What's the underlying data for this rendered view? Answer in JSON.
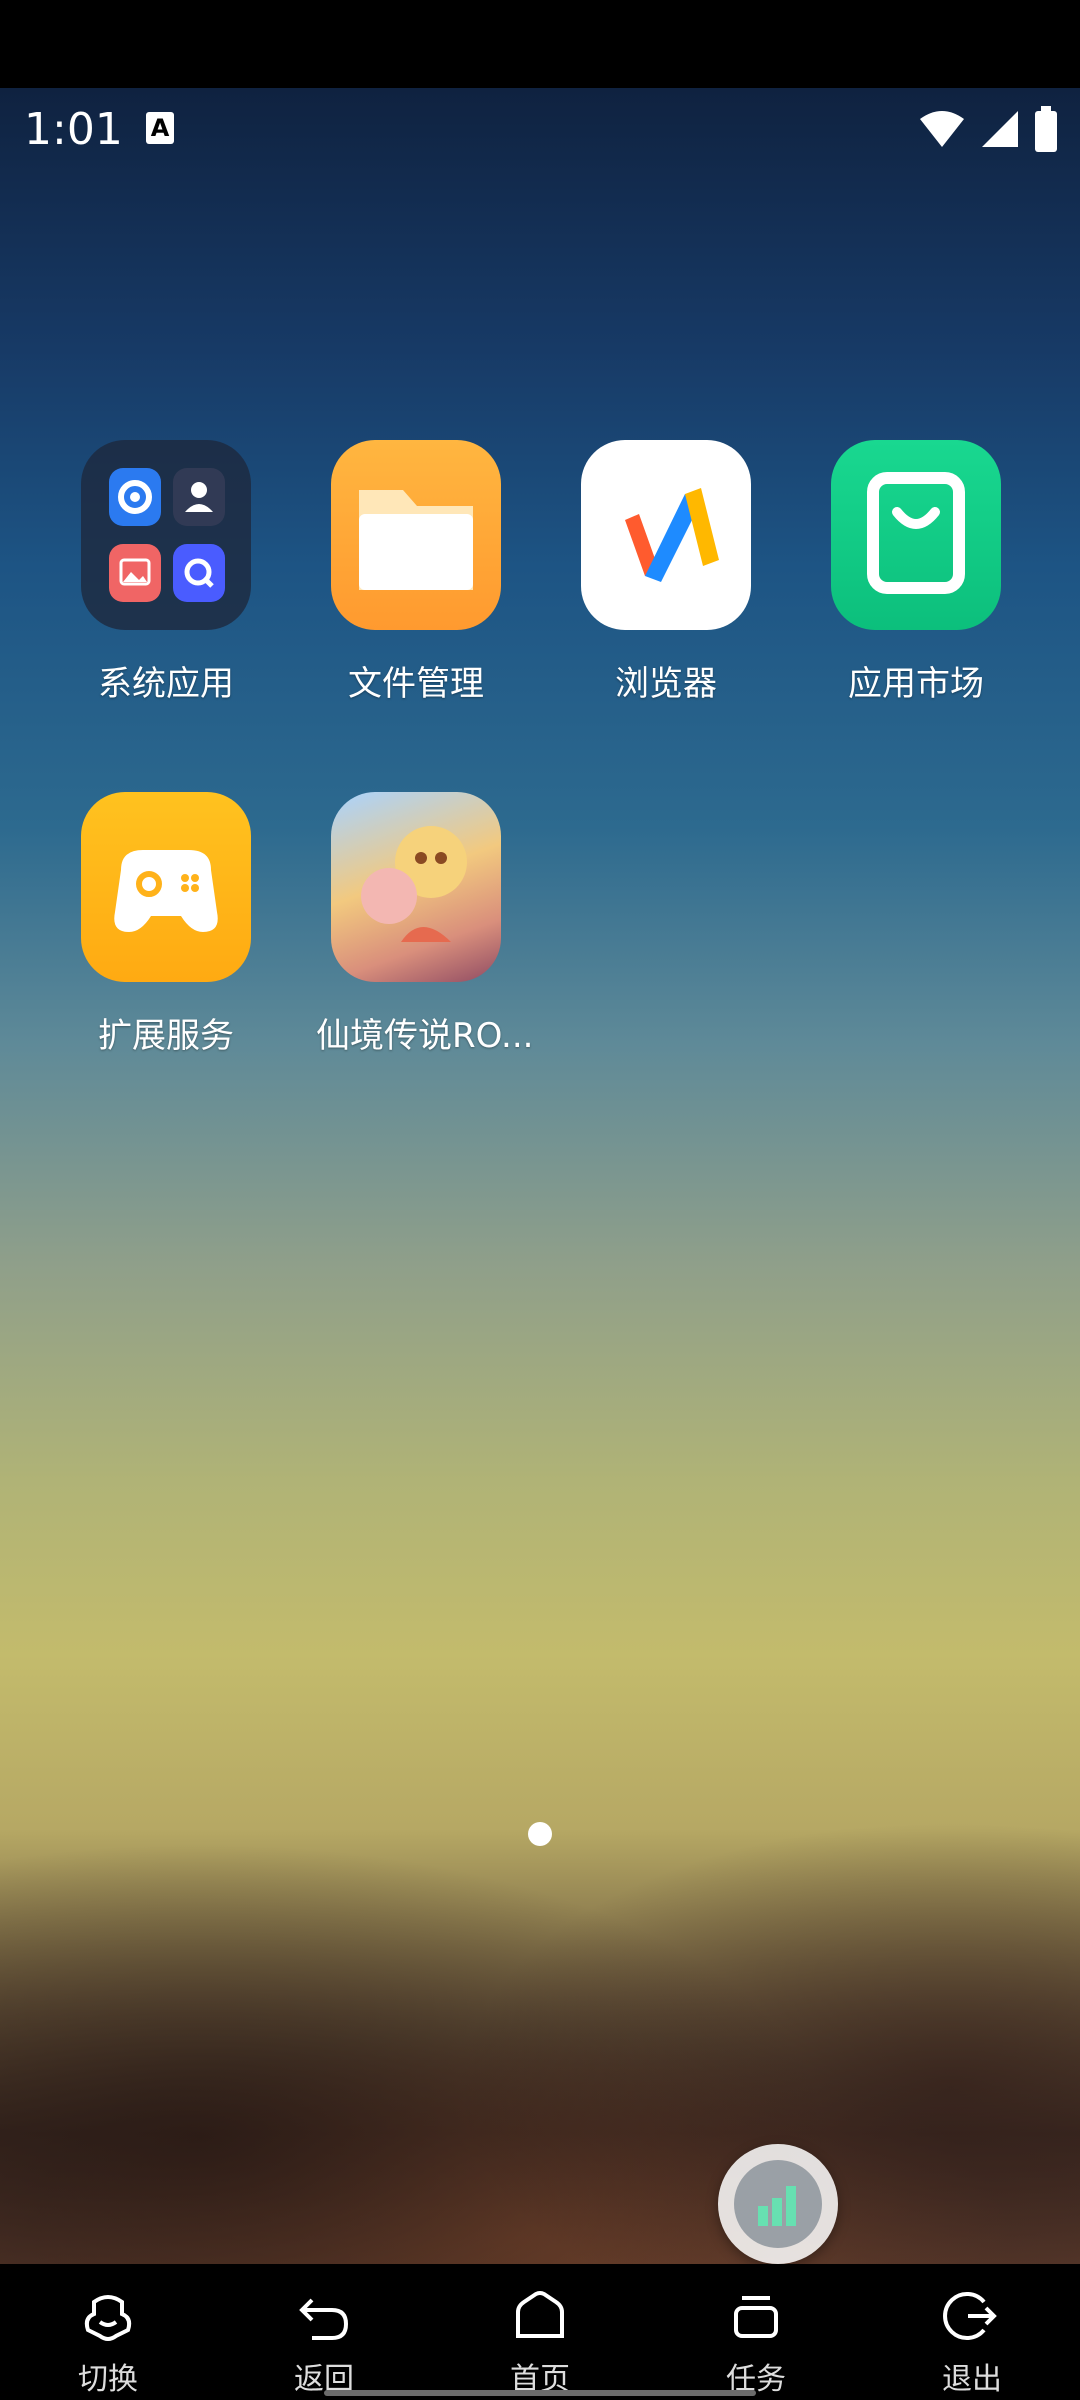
{
  "status_bar": {
    "time": "1:01",
    "indicator_letter": "A"
  },
  "apps": [
    {
      "label": "系统应用",
      "icon": "folder-icon"
    },
    {
      "label": "文件管理",
      "icon": "file-manager-icon"
    },
    {
      "label": "浏览器",
      "icon": "browser-icon"
    },
    {
      "label": "应用市场",
      "icon": "app-store-icon"
    },
    {
      "label": "扩展服务",
      "icon": "gamepad-icon"
    },
    {
      "label": "仙境传说RO...",
      "icon": "game-icon"
    }
  ],
  "bottom_nav": [
    {
      "label": "切换",
      "icon": "switch-icon"
    },
    {
      "label": "返回",
      "icon": "back-icon"
    },
    {
      "label": "首页",
      "icon": "home-icon"
    },
    {
      "label": "任务",
      "icon": "tasks-icon"
    },
    {
      "label": "退出",
      "icon": "exit-icon"
    }
  ],
  "colors": {
    "market_green": "#19d890",
    "files_orange": "#ffb640",
    "extend_yellow": "#ffc21f"
  }
}
